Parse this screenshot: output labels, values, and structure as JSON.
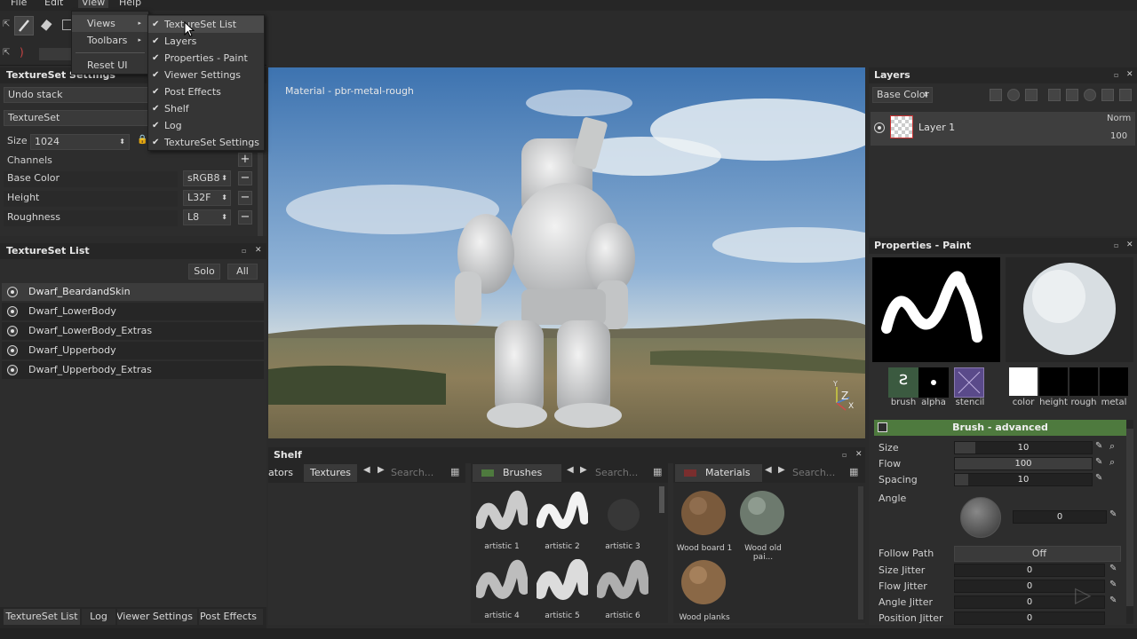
{
  "menubar": {
    "file": "File",
    "edit": "Edit",
    "view": "View",
    "help": "Help"
  },
  "view_menu": {
    "items": [
      "Views",
      "Toolbars",
      "Reset UI"
    ],
    "views_submenu": [
      "TextureSet List",
      "Layers",
      "Properties - Paint",
      "Viewer Settings",
      "Post Effects",
      "Shelf",
      "Log",
      "TextureSet Settings"
    ]
  },
  "textureset_settings": {
    "title": "TextureSet Settings",
    "undo_stack": "Undo stack",
    "textureset": "TextureSet",
    "size_label": "Size",
    "size_value": "1024",
    "channels_label": "Channels",
    "channels": [
      {
        "name": "Base Color",
        "format": "sRGB8"
      },
      {
        "name": "Height",
        "format": "L32F"
      },
      {
        "name": "Roughness",
        "format": "L8"
      }
    ]
  },
  "textureset_list": {
    "title": "TextureSet List",
    "solo": "Solo",
    "all": "All",
    "items": [
      "Dwarf_BeardandSkin",
      "Dwarf_LowerBody",
      "Dwarf_LowerBody_Extras",
      "Dwarf_Upperbody",
      "Dwarf_Upperbody_Extras"
    ]
  },
  "viewport": {
    "material_label": "Material - pbr-metal-rough",
    "axis_y": "Y",
    "axis_z": "Z",
    "axis_x": "X"
  },
  "layers": {
    "title": "Layers",
    "channel": "Base Color",
    "layer_name": "Layer 1",
    "blend": "Norm",
    "opacity": "100"
  },
  "properties": {
    "title": "Properties - Paint",
    "slots_left": [
      "brush",
      "alpha",
      "stencil"
    ],
    "slots_right": [
      "color",
      "height",
      "rough",
      "metal"
    ],
    "section": "Brush - advanced",
    "size_label": "Size",
    "size_value": "10",
    "size_fill": 0.15,
    "flow_label": "Flow",
    "flow_value": "100",
    "flow_fill": 1.0,
    "spacing_label": "Spacing",
    "spacing_value": "10",
    "spacing_fill": 0.1,
    "angle_label": "Angle",
    "angle_value": "0",
    "follow_path_label": "Follow Path",
    "follow_path_value": "Off",
    "size_jitter_label": "Size Jitter",
    "size_jitter_value": "0",
    "flow_jitter_label": "Flow Jitter",
    "flow_jitter_value": "0",
    "angle_jitter_label": "Angle Jitter",
    "angle_jitter_value": "0",
    "position_jitter_label": "Position Jitter",
    "position_jitter_value": "0"
  },
  "shelf": {
    "title": "Shelf",
    "tab1_prefix": "ators",
    "tab_textures": "Textures",
    "search_placeholder": "Search...",
    "tab_brushes": "Brushes",
    "tab_materials": "Materials",
    "brushes": [
      "artistic 1",
      "artistic 2",
      "artistic 3",
      "artistic 4",
      "artistic 5",
      "artistic 6"
    ],
    "materials": [
      "Wood board 1",
      "Wood old pai...",
      "Wood planks"
    ]
  },
  "bottom_tabs": [
    "TextureSet List",
    "Log",
    "Viewer Settings",
    "Post Effects"
  ],
  "colors": {
    "accent_green": "#4e7a3e",
    "menu_highlight": "#4a4a4a",
    "panel_bg": "#2d2d2d"
  }
}
